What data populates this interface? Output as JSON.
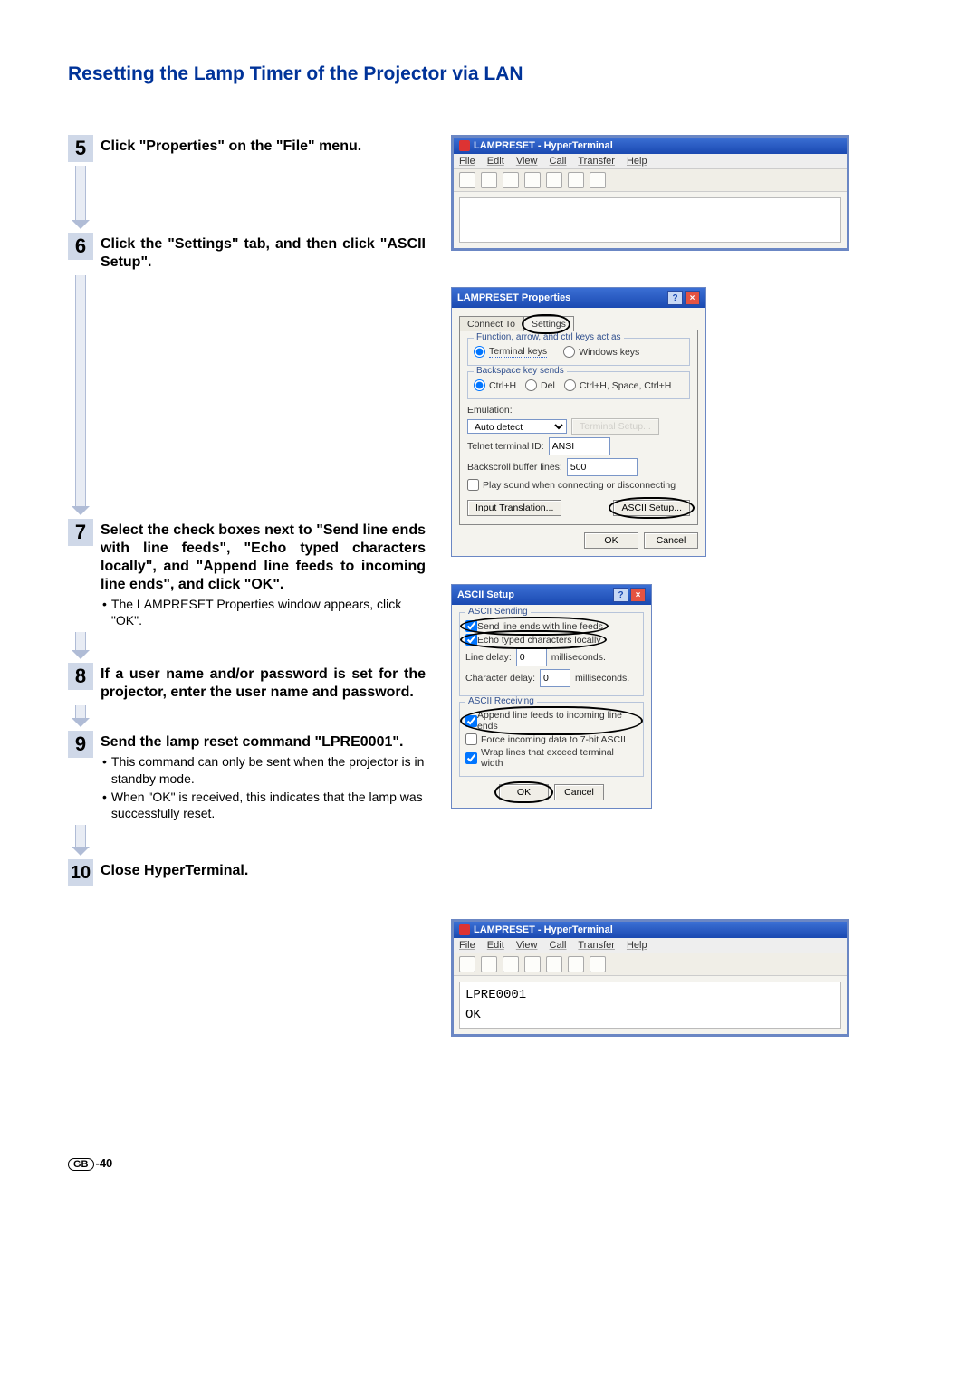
{
  "page_title": "Resetting the Lamp Timer of the Projector via LAN",
  "footer": {
    "region": "GB",
    "page": "-40"
  },
  "steps": {
    "5": {
      "title": "Click \"Properties\" on the \"File\" menu."
    },
    "6": {
      "title": "Click the \"Settings\" tab, and then click \"ASCII Setup\"."
    },
    "7": {
      "title": "Select the check boxes next to \"Send line ends with line feeds\", \"Echo typed characters locally\", and \"Append line feeds to incoming line ends\", and click \"OK\".",
      "sub": "The LAMPRESET Properties window appears, click \"OK\"."
    },
    "8": {
      "title": "If a user name and/or password is set for the projector, enter the user name and password."
    },
    "9": {
      "title": "Send the lamp reset command \"LPRE0001\".",
      "sub1": "This command can only be sent when the projector is in standby mode.",
      "sub2": "When \"OK\" is received, this indicates that the lamp was successfully reset."
    },
    "10": {
      "title": "Close HyperTerminal."
    }
  },
  "hyperterminal": {
    "title": "LAMPRESET - HyperTerminal",
    "menus": [
      "File",
      "Edit",
      "View",
      "Call",
      "Transfer",
      "Help"
    ],
    "output_lines": [
      "LPRE0001",
      "OK"
    ]
  },
  "properties_dialog": {
    "title": "LAMPRESET Properties",
    "tabs": {
      "connect": "Connect To",
      "settings": "Settings"
    },
    "group_fn": {
      "title": "Function, arrow, and ctrl keys act as",
      "opt_terminal": "Terminal keys",
      "opt_windows": "Windows keys"
    },
    "group_bk": {
      "title": "Backspace key sends",
      "opt_ctrlh": "Ctrl+H",
      "opt_del": "Del",
      "opt_ctrlh_space": "Ctrl+H, Space, Ctrl+H"
    },
    "emulation_label": "Emulation:",
    "emulation_value": "Auto detect",
    "terminal_setup_btn": "Terminal Setup...",
    "telnet_label": "Telnet terminal ID:",
    "telnet_value": "ANSI",
    "backscroll_label": "Backscroll buffer lines:",
    "backscroll_value": "500",
    "play_sound": "Play sound when connecting or disconnecting",
    "input_translation_btn": "Input Translation...",
    "ascii_setup_btn": "ASCII Setup...",
    "ok": "OK",
    "cancel": "Cancel"
  },
  "ascii_dialog": {
    "title": "ASCII Setup",
    "group_send": {
      "title": "ASCII Sending",
      "send_line_ends": "Send line ends with line feeds",
      "echo_typed": "Echo typed characters locally",
      "line_delay_label": "Line delay:",
      "line_delay_value": "0",
      "line_delay_unit": "milliseconds.",
      "char_delay_label": "Character delay:",
      "char_delay_value": "0",
      "char_delay_unit": "milliseconds."
    },
    "group_recv": {
      "title": "ASCII Receiving",
      "append_lf": "Append line feeds to incoming line ends",
      "force_7bit": "Force incoming data to 7-bit ASCII",
      "wrap_lines": "Wrap lines that exceed terminal width"
    },
    "ok": "OK",
    "cancel": "Cancel"
  }
}
